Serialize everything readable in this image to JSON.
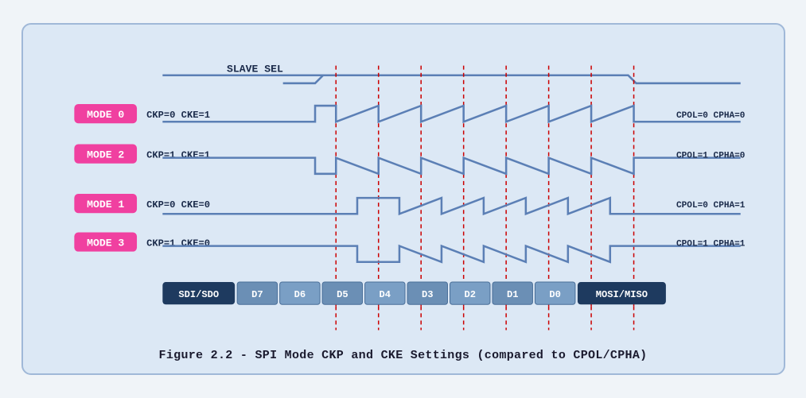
{
  "diagram": {
    "title": "Figure 2.2 - SPI Mode CKP and CKE Settings (compared to CPOL/CPHA)",
    "slave_sel_label": "SLAVE SEL",
    "modes": [
      {
        "id": "MODE 0",
        "ckp_cke": "CKP=0  CKE=1",
        "cpol_cpha": "CPOL=0  CPHA=0",
        "base_high": true
      },
      {
        "id": "MODE 2",
        "ckp_cke": "CKP=1  CKE=1",
        "cpol_cpha": "CPOL=1  CPHA=0",
        "base_high": false
      },
      {
        "id": "MODE 1",
        "ckp_cke": "CKP=0  CKE=0",
        "cpol_cpha": "CPOL=0  CPHA=1",
        "base_high": true
      },
      {
        "id": "MODE 3",
        "ckp_cke": "CKP=1  CKE=0",
        "cpol_cpha": "CPOL=1  CPHA=1",
        "base_high": false
      }
    ],
    "data_labels": [
      "SDI/SDO",
      "D7",
      "D6",
      "D5",
      "D4",
      "D3",
      "D2",
      "D1",
      "D0",
      "MOSI/MISO"
    ]
  }
}
